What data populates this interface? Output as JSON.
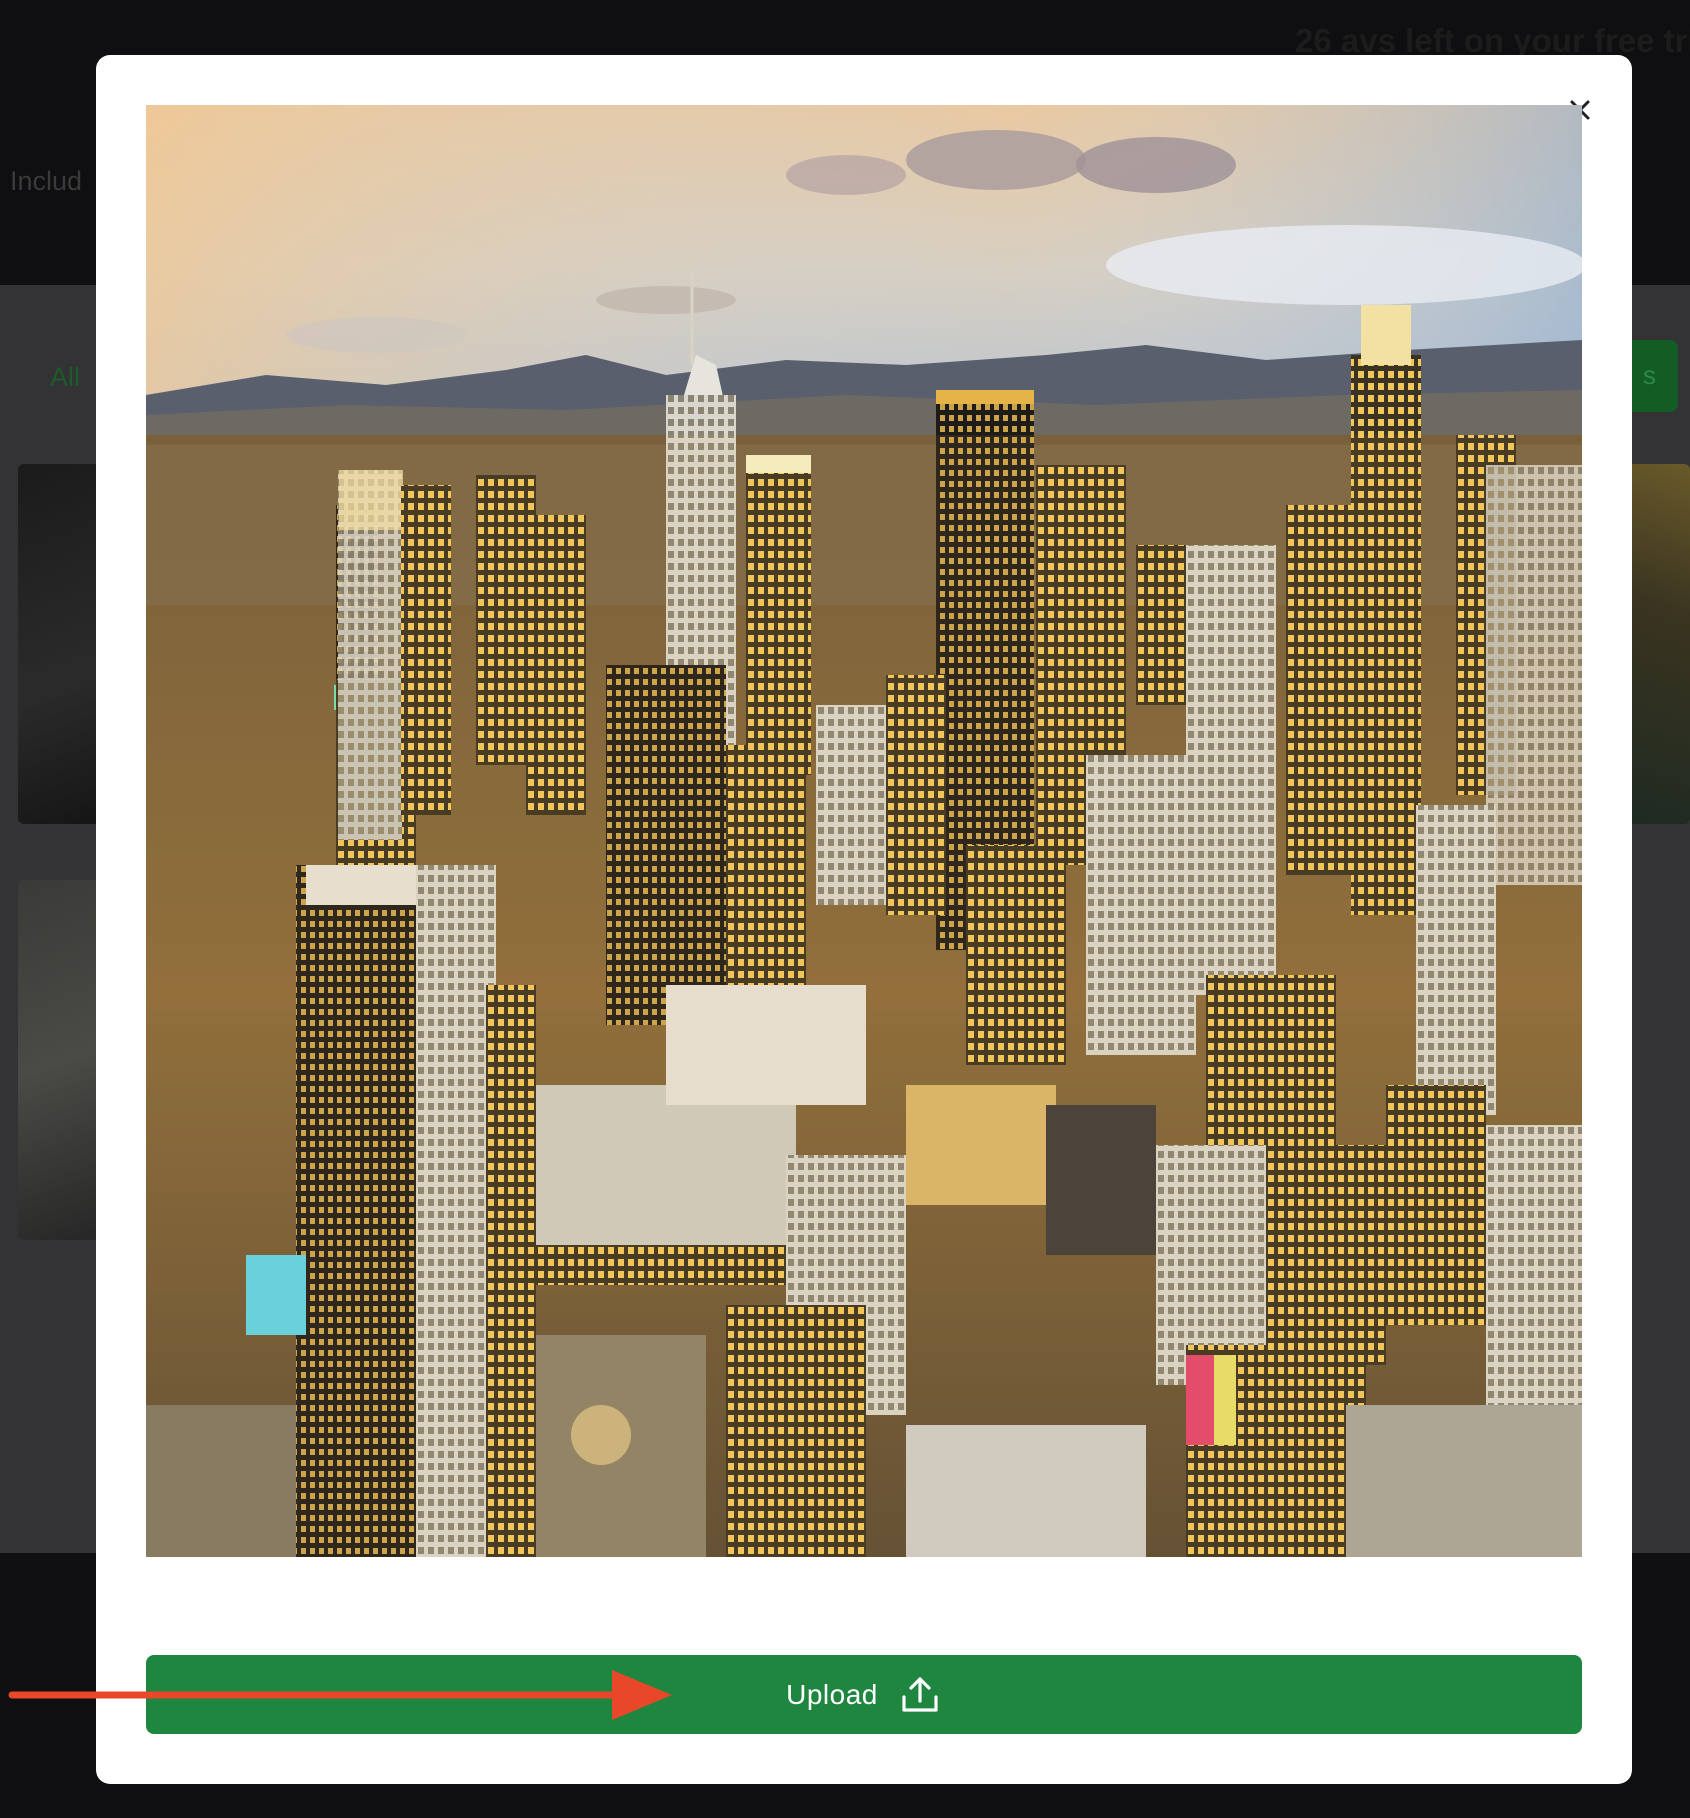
{
  "background": {
    "trial_text": "26 avs left on your free tri",
    "include_text": "Includ",
    "tab_all": "All",
    "green_button_text": "s"
  },
  "modal": {
    "close_icon": "close-icon",
    "photo_subject": "city-skyline-photo",
    "upload_button": {
      "label": "Upload",
      "icon": "upload-icon"
    }
  },
  "annotation": {
    "arrow_color": "#e8472a",
    "arrow_icon": "arrow-right-icon"
  },
  "colors": {
    "accent_green": "#1f8640",
    "backdrop": "#0e0e10"
  }
}
